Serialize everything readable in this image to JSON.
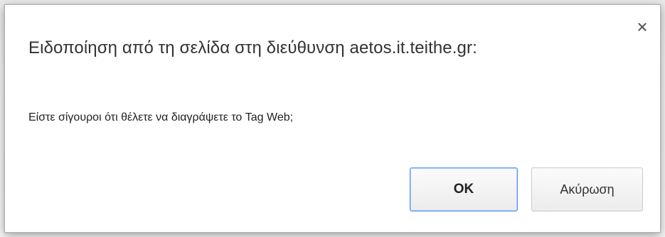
{
  "dialog": {
    "title": "Ειδοποίηση από τη σελίδα στη διεύθυνση aetos.it.teithe.gr:",
    "message": "Είστε σίγουροι ότι θέλετε να διαγράψετε το Tag Web;",
    "close_icon": "close-icon",
    "ok_label": "OK",
    "cancel_label": "Ακύρωση",
    "colors": {
      "focus_border": "#4d90fe",
      "button_border": "#c9c9c9",
      "text": "#333333"
    }
  }
}
